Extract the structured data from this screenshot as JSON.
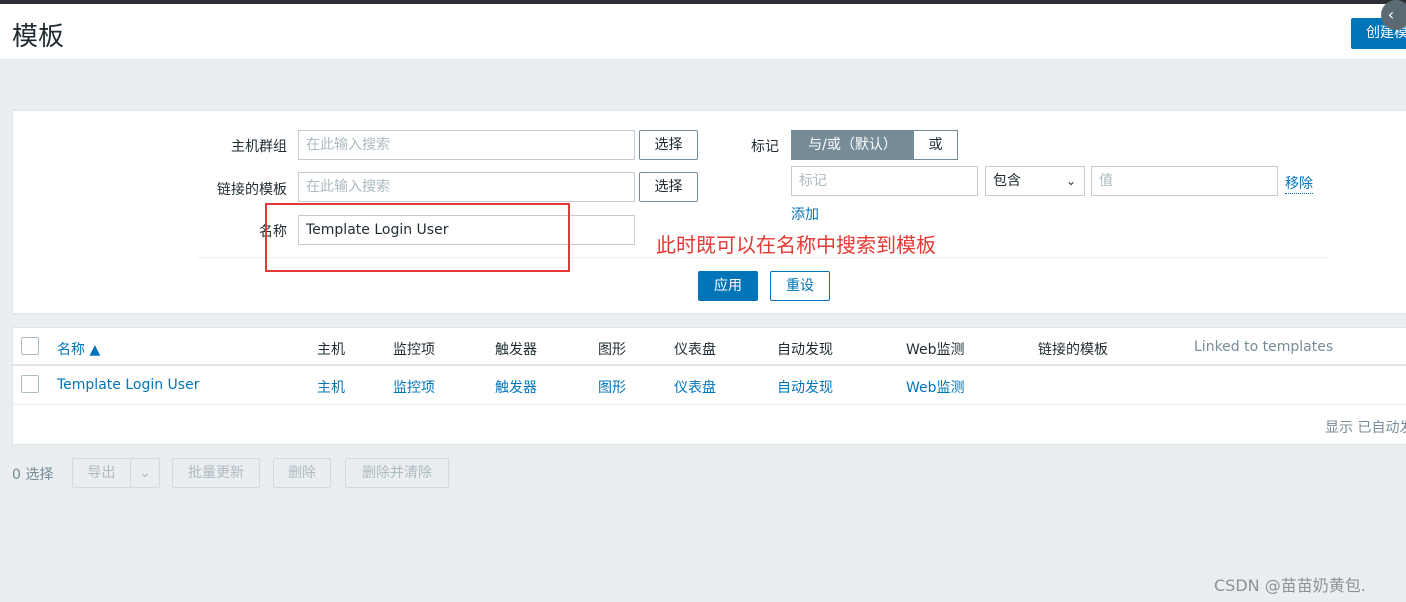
{
  "header": {
    "title": "模板",
    "create_label": "创建模板",
    "collapse_icon": "chevron-left-icon"
  },
  "filter": {
    "host_groups_label": "主机群组",
    "host_groups_placeholder": "在此输入搜索",
    "linked_templates_label": "链接的模板",
    "linked_templates_placeholder": "在此输入搜索",
    "name_label": "名称",
    "name_value": "Template Login User",
    "select_label": "选择",
    "tags_label": "标记",
    "tags_mode_and_or": "与/或（默认）",
    "tags_mode_or": "或",
    "tag_placeholder": "标记",
    "operator_value": "包含",
    "value_placeholder": "值",
    "remove_label": "移除",
    "add_label": "添加",
    "apply_label": "应用",
    "reset_label": "重设"
  },
  "annotation": "此时既可以在名称中搜索到模板",
  "table": {
    "columns": [
      "名称 ▲",
      "主机",
      "监控项",
      "触发器",
      "图形",
      "仪表盘",
      "自动发现",
      "Web监测",
      "链接的模板",
      "Linked to templates"
    ],
    "rows": [
      {
        "name": "Template Login User",
        "hosts": "主机",
        "items": "监控项",
        "triggers": "触发器",
        "graphs": "图形",
        "dashboards": "仪表盘",
        "discovery": "自动发现",
        "web": "Web监测",
        "linked": "",
        "linked_to": ""
      }
    ],
    "display_info": "显示 已自动发现"
  },
  "actions": {
    "selected": "0 选择",
    "export": "导出",
    "mass_update": "批量更新",
    "delete": "删除",
    "delete_clear": "删除并清除"
  },
  "watermark": "CSDN @苗苗奶黄包."
}
